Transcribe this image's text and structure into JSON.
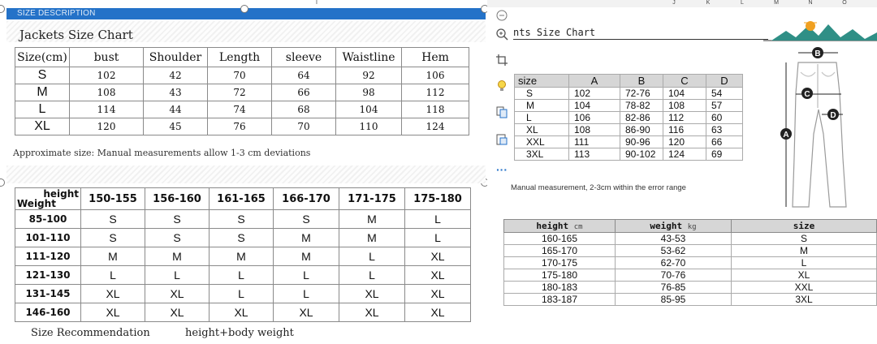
{
  "left": {
    "description_bar": "SIZE DESCRIPTION",
    "jackets_title": "Jackets Size Chart",
    "jacket_table": {
      "headers": [
        "Size(cm)",
        "bust",
        "Shoulder",
        "Length",
        "sleeve",
        "Waistline",
        "Hem"
      ],
      "rows": [
        [
          "S",
          "102",
          "42",
          "70",
          "64",
          "92",
          "106"
        ],
        [
          "M",
          "108",
          "43",
          "72",
          "66",
          "98",
          "112"
        ],
        [
          "L",
          "114",
          "44",
          "74",
          "68",
          "104",
          "118"
        ],
        [
          "XL",
          "120",
          "45",
          "76",
          "70",
          "110",
          "124"
        ]
      ]
    },
    "approx_note": "Approximate size: Manual measurements allow 1-3 cm deviations",
    "recommendation_table": {
      "corner_height": "height",
      "corner_weight": "Weight",
      "height_columns": [
        "150-155",
        "156-160",
        "161-165",
        "166-170",
        "171-175",
        "175-180"
      ],
      "rows": [
        {
          "weight": "85-100",
          "sizes": [
            "S",
            "S",
            "S",
            "S",
            "M",
            "L"
          ]
        },
        {
          "weight": "101-110",
          "sizes": [
            "S",
            "S",
            "S",
            "M",
            "M",
            "L"
          ]
        },
        {
          "weight": "111-120",
          "sizes": [
            "M",
            "M",
            "M",
            "M",
            "L",
            "XL"
          ]
        },
        {
          "weight": "121-130",
          "sizes": [
            "L",
            "L",
            "L",
            "L",
            "L",
            "XL"
          ]
        },
        {
          "weight": "131-145",
          "sizes": [
            "XL",
            "XL",
            "L",
            "L",
            "XL",
            "XL"
          ]
        },
        {
          "weight": "146-160",
          "sizes": [
            "XL",
            "XL",
            "XL",
            "XL",
            "XL",
            "XL"
          ]
        }
      ]
    },
    "size_recommendation": "Size Recommendation",
    "height_body_weight": "height+body weight"
  },
  "spreadsheet": {
    "column_letters": [
      "I",
      "J",
      "K",
      "L",
      "M",
      "N",
      "O"
    ]
  },
  "toolbar": {
    "icons": [
      "minus-icon",
      "zoom-icon",
      "crop-icon",
      "idea-icon",
      "copy-icon",
      "paste-icon",
      "more-icon"
    ]
  },
  "right": {
    "pants_title": "nts Size Chart",
    "pants_table": {
      "headers": [
        "size",
        "A",
        "B",
        "C",
        "D"
      ],
      "rows": [
        [
          "S",
          "102",
          "72-76",
          "104",
          "54"
        ],
        [
          "M",
          "104",
          "78-82",
          "108",
          "57"
        ],
        [
          "L",
          "106",
          "82-86",
          "112",
          "60"
        ],
        [
          "XL",
          "108",
          "86-90",
          "116",
          "63"
        ],
        [
          "XXL",
          "111",
          "90-96",
          "120",
          "66"
        ],
        [
          "3XL",
          "113",
          "90-102",
          "124",
          "69"
        ]
      ]
    },
    "manual_note": "Manual measurement, 2-3cm within the error range",
    "hw_table": {
      "headers": [
        {
          "label": "height",
          "unit": "cm"
        },
        {
          "label": "weight",
          "unit": "kg"
        },
        {
          "label": "size",
          "unit": ""
        }
      ],
      "rows": [
        [
          "160-165",
          "43-53",
          "S"
        ],
        [
          "165-170",
          "53-62",
          "M"
        ],
        [
          "170-175",
          "62-70",
          "L"
        ],
        [
          "175-180",
          "70-76",
          "XL"
        ],
        [
          "180-183",
          "76-85",
          "XXL"
        ],
        [
          "183-187",
          "85-95",
          "3XL"
        ]
      ]
    },
    "figure_labels": [
      "B",
      "C",
      "D",
      "A"
    ]
  },
  "colors": {
    "description_bar": "#2472c8",
    "table_header_fill": "#d6d6d6",
    "mountain_green": "#2f8f86",
    "sun_orange": "#f0a020"
  }
}
